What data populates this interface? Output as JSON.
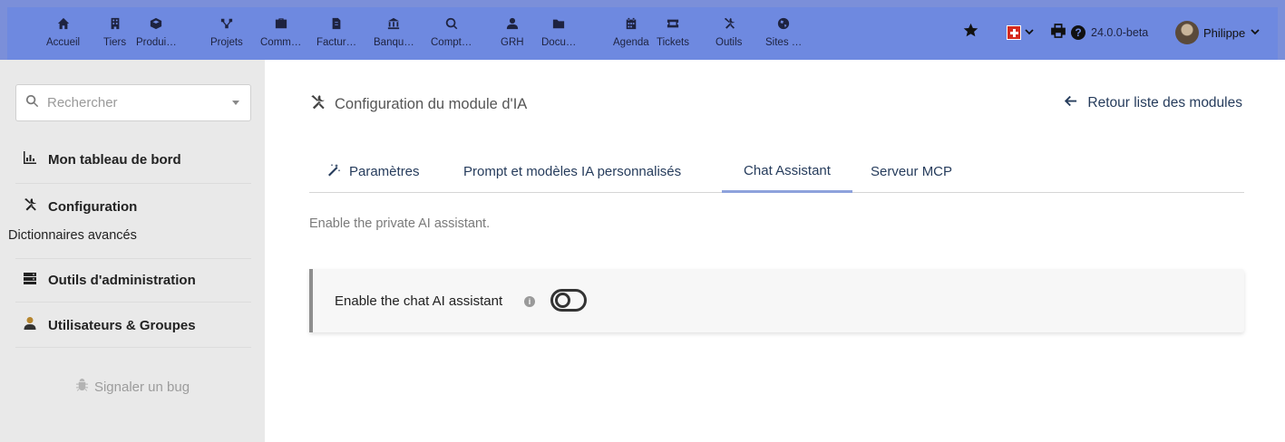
{
  "topnav": {
    "items": [
      {
        "label": "Accueil",
        "icon": "home-icon"
      },
      {
        "label": "Tiers",
        "icon": "building-icon"
      },
      {
        "label": "Produi…",
        "icon": "cube-icon"
      },
      {
        "label": "Projets",
        "icon": "project-icon"
      },
      {
        "label": "Comm…",
        "icon": "suitcase-icon"
      },
      {
        "label": "Factur…",
        "icon": "invoice-icon"
      },
      {
        "label": "Banqu…",
        "icon": "bank-icon"
      },
      {
        "label": "Compt…",
        "icon": "search-dollar-icon"
      },
      {
        "label": "GRH",
        "icon": "user-tie-icon"
      },
      {
        "label": "Docu…",
        "icon": "folder-icon"
      },
      {
        "label": "Agenda",
        "icon": "calendar-icon"
      },
      {
        "label": "Tickets",
        "icon": "ticket-icon"
      },
      {
        "label": "Outils",
        "icon": "tools-icon"
      },
      {
        "label": "Sites …",
        "icon": "globe-icon"
      }
    ],
    "version": "24.0.0-beta",
    "user_name": "Philippe"
  },
  "sidebar": {
    "search_placeholder": "Rechercher",
    "menus": [
      {
        "title": "Mon tableau de bord",
        "icon": "chart-icon"
      },
      {
        "title": "Configuration",
        "icon": "tools-icon",
        "sub": "Dictionnaires avancés"
      },
      {
        "title": "Outils d'administration",
        "icon": "server-icon"
      },
      {
        "title": "Utilisateurs & Groupes",
        "icon": "user-icon"
      }
    ],
    "bug_label": "Signaler un bug"
  },
  "main": {
    "title": "Configuration du module d'IA",
    "back_label": "Retour liste des modules",
    "tabs": [
      {
        "label": "Paramètres"
      },
      {
        "label": "Prompt et modèles IA personnalisés"
      },
      {
        "label": "Chat Assistant"
      },
      {
        "label": "Serveur MCP"
      }
    ],
    "description": "Enable the private AI assistant.",
    "setting_label": "Enable the chat AI assistant",
    "setting_enabled": false
  },
  "colors": {
    "topbar": "#6e89e0",
    "sidebar": "#e9e9e9",
    "link": "#263c5c",
    "active_tab_underline": "#8ea2dc"
  }
}
